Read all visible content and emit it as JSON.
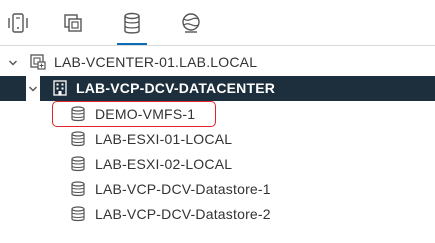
{
  "tabs": [
    {
      "name": "hosts-and-clusters",
      "icon": "hosts-clusters-icon",
      "active": false
    },
    {
      "name": "vms-and-templates",
      "icon": "vms-templates-icon",
      "active": false
    },
    {
      "name": "storage",
      "icon": "storage-icon",
      "active": true
    },
    {
      "name": "networking",
      "icon": "networking-icon",
      "active": false
    }
  ],
  "tree": {
    "vcenter": {
      "label": "LAB-VCENTER-01.LAB.LOCAL",
      "icon": "vcenter-icon",
      "expanded": true
    },
    "datacenter": {
      "label": "LAB-VCP-DCV-DATACENTER",
      "icon": "datacenter-icon",
      "expanded": true,
      "selected": true
    },
    "datastores": [
      {
        "label": "DEMO-VMFS-1",
        "icon": "datastore-icon",
        "highlighted": true
      },
      {
        "label": "LAB-ESXI-01-LOCAL",
        "icon": "datastore-icon"
      },
      {
        "label": "LAB-ESXI-02-LOCAL",
        "icon": "datastore-icon"
      },
      {
        "label": "LAB-VCP-DCV-Datastore-1",
        "icon": "datastore-icon"
      },
      {
        "label": "LAB-VCP-DCV-Datastore-2",
        "icon": "datastore-icon"
      }
    ]
  },
  "colors": {
    "selected_bg": "#1d2f3c",
    "active_tab": "#0b6db5",
    "highlight_border": "#e0262b",
    "text": "#333333"
  }
}
